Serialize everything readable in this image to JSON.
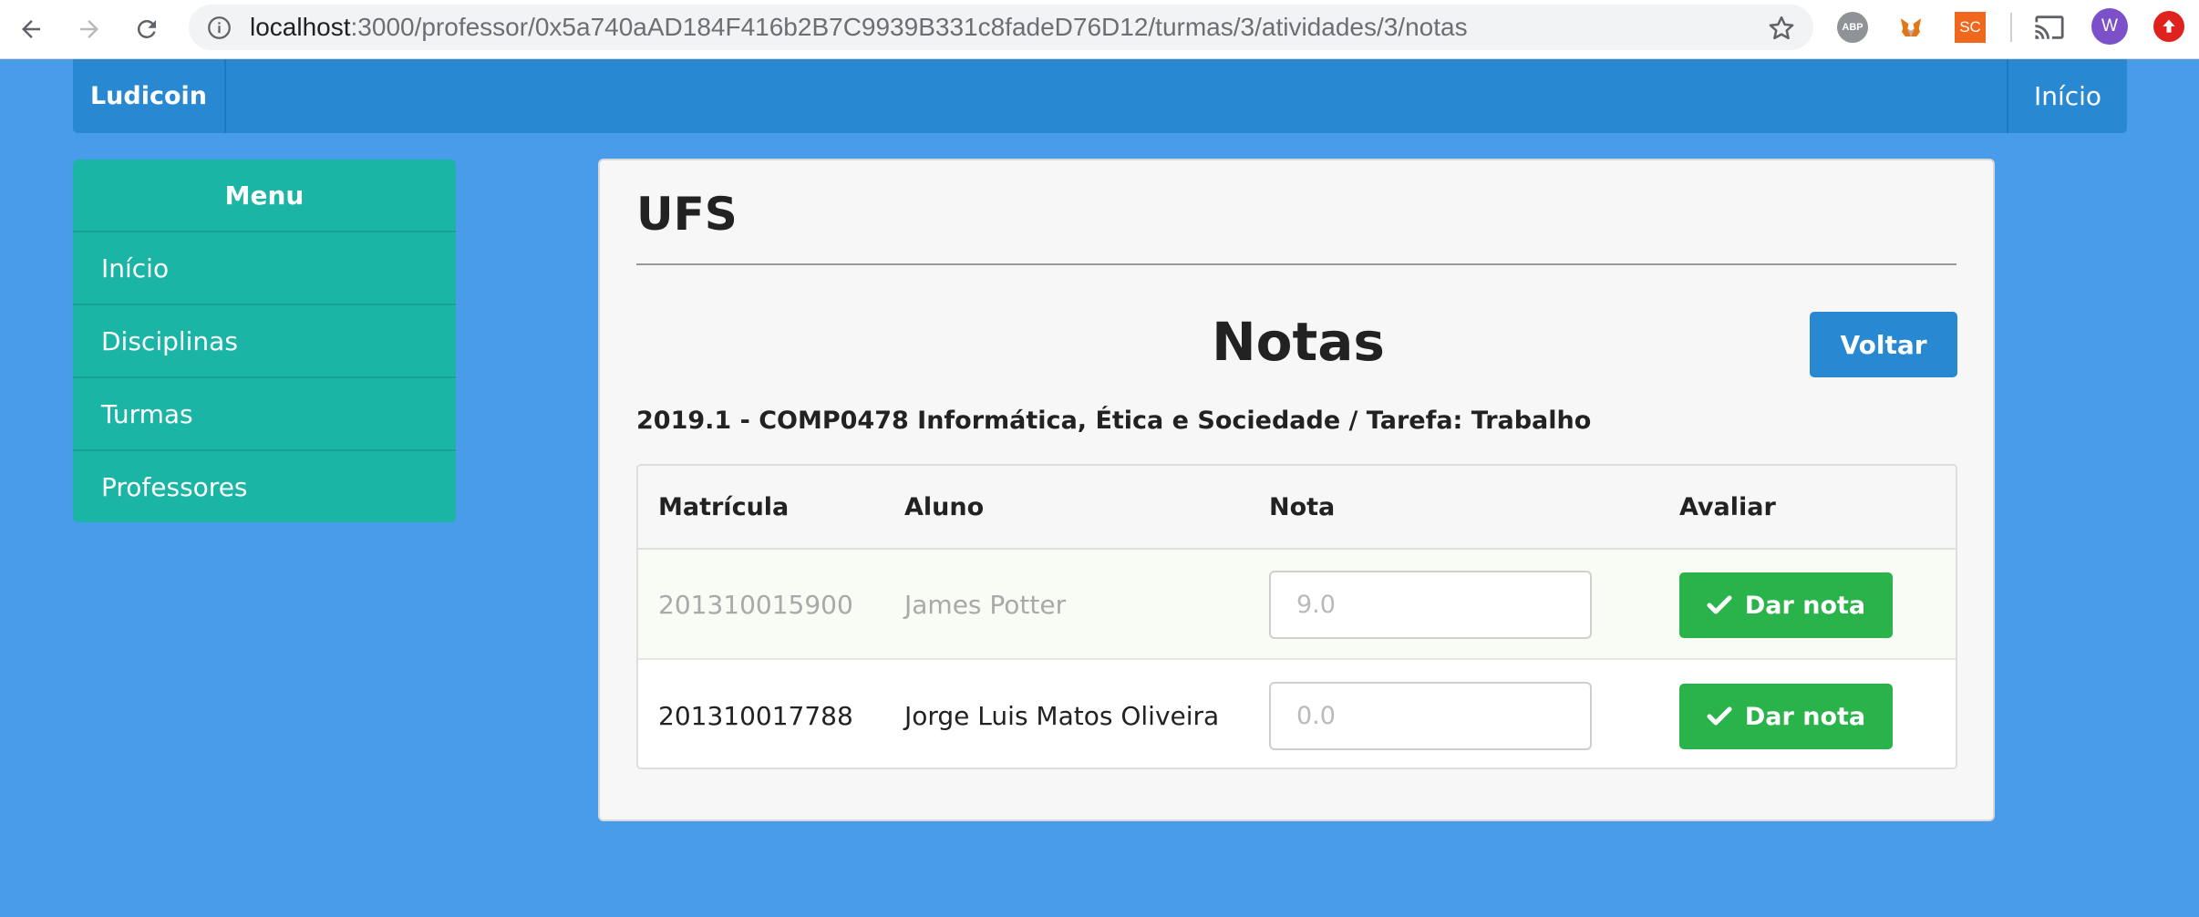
{
  "browser": {
    "url_host": "localhost",
    "url_path": ":3000/professor/0x5a740aAD184F416b2B7C9939B331c8fadeD76D12/turmas/3/atividades/3/notas",
    "extensions": {
      "abp_label": "ABP",
      "sc_label": "SC",
      "avatar_letter": "W"
    }
  },
  "navbar": {
    "brand": "Ludicoin",
    "home_link": "Início"
  },
  "sidebar": {
    "title": "Menu",
    "items": [
      {
        "label": "Início"
      },
      {
        "label": "Disciplinas"
      },
      {
        "label": "Turmas"
      },
      {
        "label": "Professores"
      }
    ]
  },
  "main": {
    "institution": "UFS",
    "page_title": "Notas",
    "back_button": "Voltar",
    "subtitle": "2019.1 - COMP0478 Informática, Ética e Sociedade / Tarefa: Trabalho",
    "table": {
      "headers": {
        "matricula": "Matrícula",
        "aluno": "Aluno",
        "nota": "Nota",
        "avaliar": "Avaliar"
      },
      "rows": [
        {
          "matricula": "201310015900",
          "aluno": "James Potter",
          "nota_placeholder": "9.0",
          "button": "Dar nota"
        },
        {
          "matricula": "201310017788",
          "aluno": "Jorge Luis Matos Oliveira",
          "nota_placeholder": "0.0",
          "button": "Dar nota"
        }
      ]
    }
  },
  "colors": {
    "page_background": "#489ce9",
    "navbar": "#2888d1",
    "sidebar": "#1bb5a5",
    "success_button": "#2ab34a",
    "primary_button": "#2888d1"
  }
}
